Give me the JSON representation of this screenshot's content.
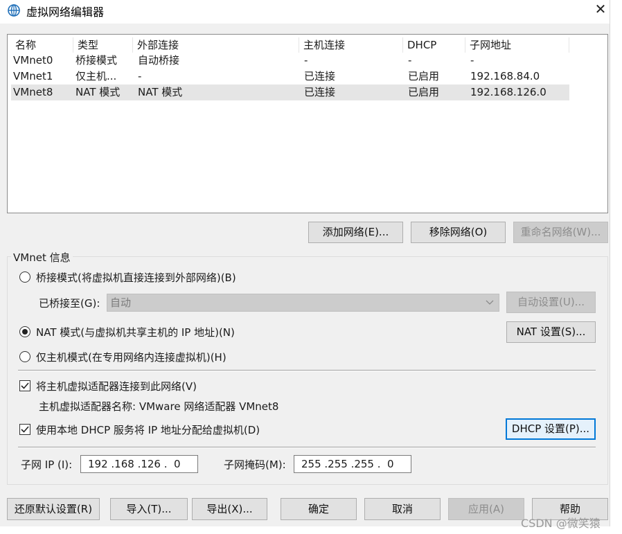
{
  "window": {
    "title": "虚拟网络编辑器",
    "close": "✕"
  },
  "list": {
    "columns": [
      "名称",
      "类型",
      "外部连接",
      "主机连接",
      "DHCP",
      "子网地址"
    ],
    "rows": [
      {
        "name": "VMnet0",
        "type": "桥接模式",
        "external": "自动桥接",
        "host": "-",
        "dhcp": "-",
        "subnet": "-"
      },
      {
        "name": "VMnet1",
        "type": "仅主机...",
        "external": "-",
        "host": "已连接",
        "dhcp": "已启用",
        "subnet": "192.168.84.0"
      },
      {
        "name": "VMnet8",
        "type": "NAT 模式",
        "external": "NAT 模式",
        "host": "已连接",
        "dhcp": "已启用",
        "subnet": "192.168.126.0"
      }
    ],
    "selected_index": 2
  },
  "list_buttons": {
    "add": "添加网络(E)...",
    "remove": "移除网络(O)",
    "rename": "重命名网络(W)..."
  },
  "vmnet_info": {
    "group_title": "VMnet 信息",
    "bridge_radio": "桥接模式(将虚拟机直接连接到外部网络)(B)",
    "bridged_to_label": "已桥接至(G):",
    "bridged_to_value": "自动",
    "auto_settings": "自动设置(U)...",
    "nat_radio": "NAT 模式(与虚拟机共享主机的 IP 地址)(N)",
    "nat_settings": "NAT 设置(S)...",
    "hostonly_radio": "仅主机模式(在专用网络内连接虚拟机)(H)",
    "selected_mode": "nat",
    "connect_adapter_check": "将主机虚拟适配器连接到此网络(V)",
    "connect_adapter_checked": true,
    "adapter_name_text": "主机虚拟适配器名称: VMware 网络适配器 VMnet8",
    "dhcp_check": "使用本地 DHCP 服务将 IP 地址分配给虚拟机(D)",
    "dhcp_checked": true,
    "dhcp_settings": "DHCP 设置(P)...",
    "subnet_ip_label": "子网 IP (I):",
    "subnet_ip_value": "192 .168 .126 .  0",
    "subnet_mask_label": "子网掩码(M):",
    "subnet_mask_value": "255 .255 .255 .  0"
  },
  "bottom_buttons": {
    "restore": "还原默认设置(R)",
    "import": "导入(T)...",
    "export": "导出(X)...",
    "ok": "确定",
    "cancel": "取消",
    "apply": "应用(A)",
    "help": "帮助"
  },
  "watermark": "CSDN @微笑猿",
  "icons": {
    "title_icon": "globe-network-icon",
    "combo_arrow": "chevron-down-icon",
    "check_mark": "checkmark-icon"
  },
  "colors": {
    "accent": "#0078d7",
    "selected_row": "#e5e5e5",
    "disabled_fill": "#cccccc"
  }
}
